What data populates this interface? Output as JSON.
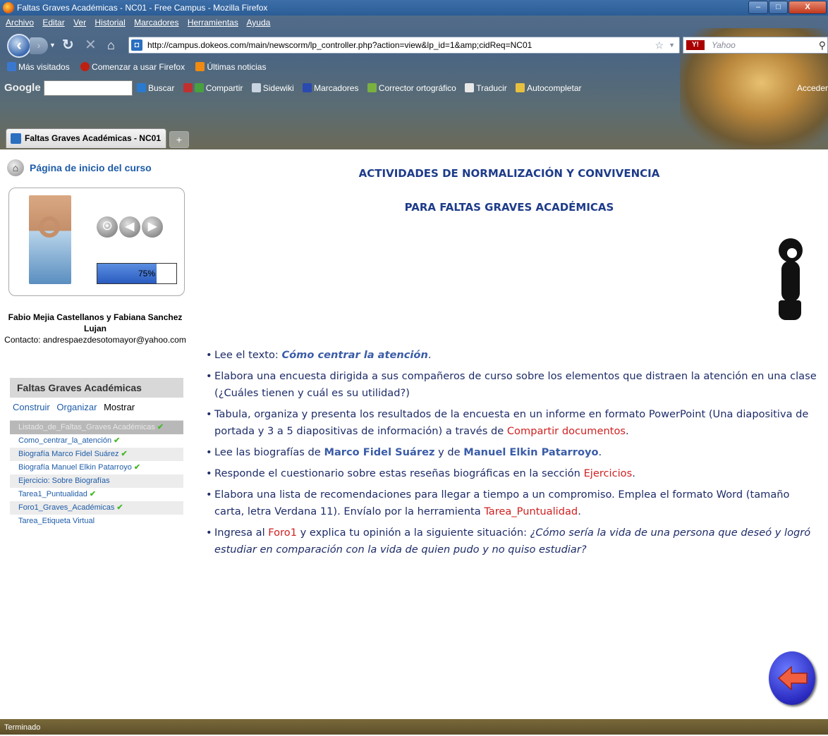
{
  "window": {
    "title": "Faltas Graves Académicas - NC01 - Free Campus - Mozilla Firefox",
    "min_label": "–",
    "max_label": "□",
    "close_label": "X"
  },
  "menu": [
    "Archivo",
    "Editar",
    "Ver",
    "Historial",
    "Marcadores",
    "Herramientas",
    "Ayuda"
  ],
  "navigation": {
    "url": "http://campus.dokeos.com/main/newscorm/lp_controller.php?action=view&lp_id=1&amp;cidReq=NC01",
    "search_placeholder": "Yahoo",
    "search_engine_label": "Y!"
  },
  "bookmarks": [
    "Más visitados",
    "Comenzar a usar Firefox",
    "Últimas noticias"
  ],
  "google_toolbar": {
    "logo": "Google",
    "items": [
      "Buscar",
      "Compartir",
      "Sidewiki",
      "Marcadores",
      "Corrector ortográfico",
      "Traducir",
      "Autocompletar"
    ],
    "account": "Acceder"
  },
  "tabs": {
    "active": "Faltas Graves Académicas - NC01 - F",
    "new_tab": "+"
  },
  "sidebar": {
    "home_link": "Página de inicio del curso",
    "progress_percent": 75,
    "progress_label": "75%",
    "authors": "Fabio Mejia Castellanos y Fabiana Sanchez Lujan",
    "contact": "Contacto: andrespaezdesotomayor@yahoo.com",
    "toc_title": "Faltas Graves Académicas",
    "toc_actions": [
      "Construir",
      "Organizar",
      "Mostrar"
    ],
    "toc_items": [
      {
        "label": "Listado_de_Faltas_Graves Académicas",
        "done": true
      },
      {
        "label": "Como_centrar_la_atención",
        "done": true
      },
      {
        "label": "Biografía Marco Fidel Suárez",
        "done": true
      },
      {
        "label": "Biografía Manuel Elkin Patarroyo",
        "done": true
      },
      {
        "label": "Ejercicio: Sobre Biografías",
        "done": false
      },
      {
        "label": "Tarea1_Puntualidad",
        "done": true
      },
      {
        "label": "Foro1_Graves_Académicas",
        "done": true
      },
      {
        "label": "Tarea_Etiqueta Virtual",
        "done": false
      }
    ]
  },
  "content": {
    "title_line1": "ACTIVIDADES DE NORMALIZACIÓN Y CONVIVENCIA",
    "title_line2": "PARA FALTAS GRAVES ACADÉMICAS",
    "b1_pre": "Lee el texto: ",
    "b1_link": "Cómo centrar la atención",
    "b1_post": ".",
    "b2": "Elabora una encuesta dirigida a sus compañeros de curso sobre los elementos que distraen la atención en una clase (¿Cuáles tienen y cuál es su utilidad?)",
    "b3_pre": "Tabula, organiza y presenta los resultados de la encuesta en un informe en formato PowerPoint (Una diapositiva de portada y 3 a 5 diapositivas de información) a través de ",
    "b3_link": "Compartir documentos",
    "b3_post": ".",
    "b4_pre": "Lee las biografías de ",
    "b4_link1": "Marco Fidel Suárez",
    "b4_mid": " y de ",
    "b4_link2": "Manuel Elkin Patarroyo",
    "b4_post": ".",
    "b5_pre": "Responde el cuestionario sobre estas reseñas biográficas en la sección ",
    "b5_link": "Ejercicios",
    "b5_post": ".",
    "b6_pre": "Elabora una lista de recomendaciones para llegar a tiempo a un compromiso. Emplea el formato Word (tamaño carta, letra Verdana 11). Envíalo por la herramienta ",
    "b6_link": "Tarea_Puntualidad",
    "b6_post": ".",
    "b7_pre": "Ingresa al ",
    "b7_link": "Foro1",
    "b7_mid": " y explica tu opinión a la siguiente situación: ",
    "b7_ital": "¿Cómo sería la vida de una persona que deseó y logró estudiar en comparación con la vida de quien pudo y no quiso estudiar?"
  },
  "status": "Terminado",
  "colors": {
    "title": "#1e3c8a",
    "link_red": "#d02020",
    "link_blue": "#3a5ca8",
    "check": "#4ab82c"
  }
}
